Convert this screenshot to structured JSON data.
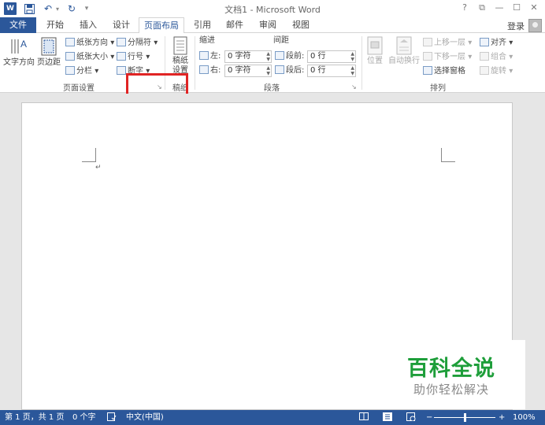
{
  "titlebar": {
    "title": "文档1 - Microsoft Word",
    "word_icon": "W",
    "save_icon": "save-icon",
    "undo_glyph": "↶",
    "redo_glyph": "↻",
    "customize_glyph": "▾",
    "help": "?",
    "restore_ribbon": "⧉",
    "minimize": "—",
    "maximize": "☐",
    "close": "✕"
  },
  "tabs": {
    "file": "文件",
    "home": "开始",
    "insert": "插入",
    "design": "设计",
    "page_layout": "页面布局",
    "references": "引用",
    "mailings": "邮件",
    "review": "审阅",
    "view": "视图",
    "login": "登录"
  },
  "ribbon": {
    "page_setup": {
      "label": "页面设置",
      "text_direction": "文字方向",
      "margins": "页边距",
      "orientation": "纸张方向",
      "size": "纸张大小",
      "columns": "分栏",
      "breaks": "分隔符",
      "line_numbers": "行号",
      "hyphenation": "断字",
      "dropdown": "▾"
    },
    "manuscript": {
      "label": "稿纸",
      "settings_line1": "稿纸",
      "settings_line2": "设置"
    },
    "paragraph": {
      "label": "段落",
      "indent": "缩进",
      "spacing": "间距",
      "left_label": "左:",
      "left_value": "0 字符",
      "right_label": "右:",
      "right_value": "0 字符",
      "before_label": "段前:",
      "before_value": "0 行",
      "after_label": "段后:",
      "after_value": "0 行"
    },
    "arrange": {
      "label": "排列",
      "position": "位置",
      "wrap_text": "自动换行",
      "bring_forward": "上移一层",
      "send_backward": "下移一层",
      "selection_pane": "选择窗格",
      "align": "对齐",
      "group": "组合",
      "rotate": "旋转"
    },
    "launcher_glyph": "↘"
  },
  "document": {
    "paragraph_mark": "↵"
  },
  "watermark": {
    "line1": "百科全说",
    "line2": "助你轻松解决"
  },
  "statusbar": {
    "page": "第 1 页，共 1 页",
    "words": "0 个字",
    "language": "中文(中国)",
    "zoom": "100%",
    "zoom_minus": "−",
    "zoom_plus": "+",
    "zoom_level": 1.0
  },
  "colors": {
    "accent": "#2b579a",
    "highlight": "#e02424",
    "watermark_green": "#1e9e3a"
  }
}
